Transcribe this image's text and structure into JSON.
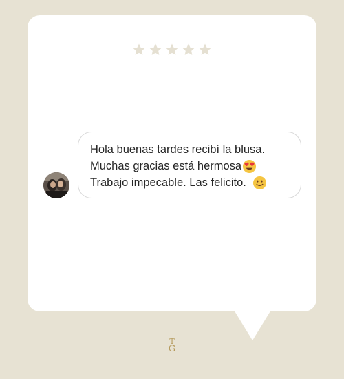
{
  "rating": {
    "stars": 5,
    "color": "#e5e0d2"
  },
  "message": {
    "line1": "Hola buenas tardes recibí la blusa.",
    "line2": "Muchas gracias está hermosa",
    "line3": "Trabajo impecable. Las felicito.",
    "emoji_line2": "heart-eyes-emoji",
    "emoji_line3": "slight-smile-emoji"
  },
  "brand": {
    "monogram": "TG",
    "color": "#b59a5c"
  },
  "colors": {
    "background": "#e7e2d3",
    "card": "#ffffff",
    "bubble_border": "#d8d8d8"
  }
}
